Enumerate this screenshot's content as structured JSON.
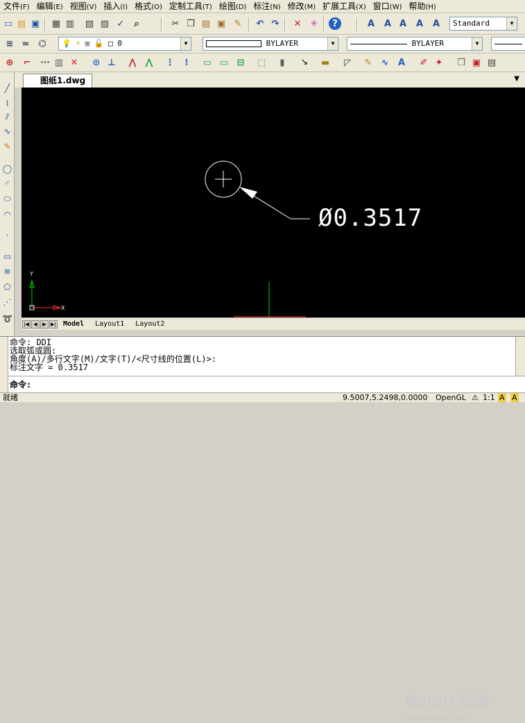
{
  "menu": [
    {
      "label": "文件",
      "acc": "(F)"
    },
    {
      "label": "编辑",
      "acc": "(E)"
    },
    {
      "label": "视图",
      "acc": "(V)"
    },
    {
      "label": "插入",
      "acc": "(I)"
    },
    {
      "label": "格式",
      "acc": "(O)"
    },
    {
      "label": "定制工具",
      "acc": "(T)"
    },
    {
      "label": "绘图",
      "acc": "(D)"
    },
    {
      "label": "标注",
      "acc": "(N)"
    },
    {
      "label": "修改",
      "acc": "(M)"
    },
    {
      "label": "扩展工具",
      "acc": "(X)"
    },
    {
      "label": "窗口",
      "acc": "(W)"
    },
    {
      "label": "帮助",
      "acc": "(H)"
    }
  ],
  "toolbar": {
    "text_style": "Standard",
    "layer_value": "0",
    "color_value": "BYLAYER",
    "linetype_value": "BYLAYER"
  },
  "document": {
    "tab_title": "图纸1.dwg"
  },
  "drawing": {
    "dimension_text": "Ø0.3517",
    "ucs_x": "X",
    "ucs_y": "Y"
  },
  "layout_tabs": [
    "Model",
    "Layout1",
    "Layout2"
  ],
  "command": {
    "history": [
      "命令:  DDI",
      "选取弧或圆:",
      "角度(A)/多行文字(M)/文字(T)/<尺寸线的位置(L)>:",
      "标注文字 = 0.3517"
    ],
    "prompt": "命令:"
  },
  "status": {
    "ready": "就绪",
    "coords": "9.5007,5.2498,0.0000",
    "renderer": "OpenGL",
    "scale": "1:1"
  },
  "watermark": {
    "brand": "Baidu 经验",
    "url": "jingyan.baidu.com"
  },
  "colors": {
    "canvas": "#000000",
    "dim_line": "#ffffff",
    "ucs_x": "#ff3030",
    "ucs_y": "#00cc00"
  }
}
